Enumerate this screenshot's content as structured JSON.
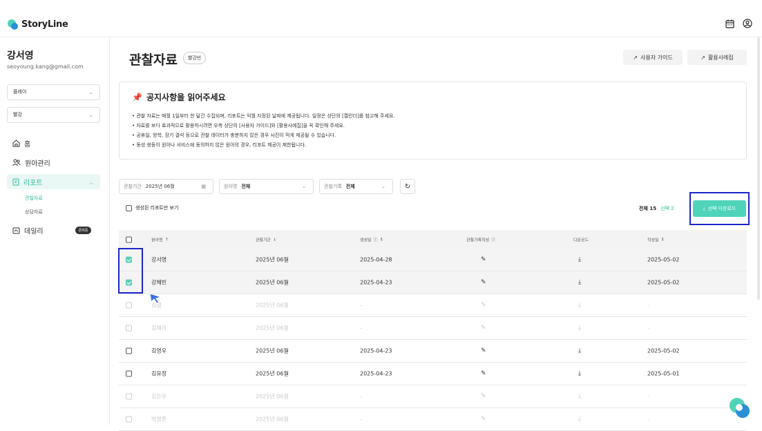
{
  "app": {
    "name": "StoryLine"
  },
  "user": {
    "name": "강서영",
    "email": "seoyoung.kang@gmail.com"
  },
  "sidebar": {
    "select1": "플레이",
    "select2": "빨강",
    "nav": [
      {
        "label": "홈"
      },
      {
        "label": "원아관리"
      },
      {
        "label": "리포트"
      },
      {
        "label": "데일리",
        "badge": "준비중"
      }
    ],
    "report_sub": [
      "관찰자료",
      "상담자료"
    ]
  },
  "header": {
    "title": "관찰자료",
    "class_chip": "빨강반",
    "guide_button": "사용자 가이드",
    "cases_button": "활용사례집"
  },
  "notice": {
    "title": "공지사항을 읽어주세요",
    "items": [
      "관찰 자료는 매월 1일부터 한 달간 수집되며, 리포트는 익월 지정된 날짜에 제공됩니다. 일정은 상단의 [캘린더]를 참고해 주세요.",
      "자료를 보다 효과적으로 활용하시려면 우측 상단의 [사용자 가이드]와 [활용사례집]을 꼭 확인해 주세요.",
      "공휴일, 방학, 장기 결석 등으로 관찰 데이터가 충분하지 않은 경우 사진이 적게 제공될 수 있습니다.",
      "동성 쌍둥이 원아나 서비스에 동의하지 않은 원아의 경우, 리포트 제공이 제한됩니다."
    ]
  },
  "filters": {
    "period_label": "관찰기간",
    "period_value": "2025년 06월",
    "child_label": "원아명",
    "child_value": "전체",
    "record_label": "관찰기록",
    "record_value": "전체"
  },
  "toolbar": {
    "generated_only": "생성된 리포트만 보기",
    "total": "전체 15",
    "selected": "선택 2",
    "download_selected": "선택 다운로드"
  },
  "table": {
    "headers": [
      "원아명",
      "관찰기간",
      "생성일",
      "관찰기록작성",
      "다운로드",
      "작성일"
    ],
    "rows": [
      {
        "name": "강서영",
        "period": "2025년 06월",
        "created": "2025-04-28",
        "written": "2025-05-02",
        "checked": true,
        "enabled": true
      },
      {
        "name": "강혜빈",
        "period": "2025년 06월",
        "created": "2025-04-23",
        "written": "2025-05-02",
        "checked": true,
        "enabled": true
      },
      {
        "name": "김철",
        "period": "2025년 06월",
        "created": "-",
        "written": "-",
        "checked": false,
        "enabled": false
      },
      {
        "name": "김채리",
        "period": "2025년 06월",
        "created": "-",
        "written": "-",
        "checked": false,
        "enabled": false
      },
      {
        "name": "김영우",
        "period": "2025년 06월",
        "created": "2025-04-23",
        "written": "2025-05-02",
        "checked": false,
        "enabled": true
      },
      {
        "name": "김유정",
        "period": "2025년 06월",
        "created": "2025-04-23",
        "written": "2025-05-01",
        "checked": false,
        "enabled": true
      },
      {
        "name": "김은우",
        "period": "2025년 06월",
        "created": "-",
        "written": "-",
        "checked": false,
        "enabled": false
      },
      {
        "name": "박영준",
        "period": "2025년 06월",
        "created": "-",
        "written": "-",
        "checked": false,
        "enabled": false
      }
    ]
  },
  "colors": {
    "accent": "#4fd3b9",
    "highlight_box": "#1a26c9"
  }
}
